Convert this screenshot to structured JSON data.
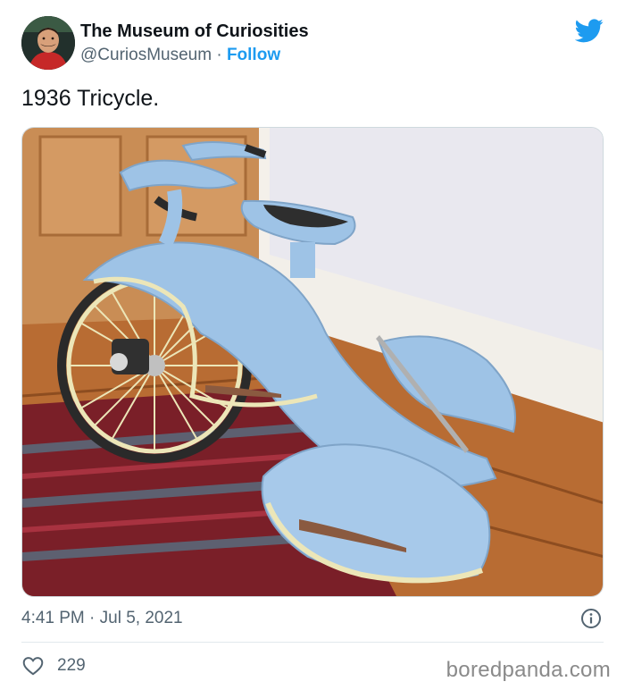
{
  "author": {
    "name": "The Museum of Curiosities",
    "handle": "@CuriosMuseum",
    "separator": " · ",
    "follow_label": "Follow"
  },
  "tweet": {
    "text": "1936 Tricycle.",
    "timestamp": "4:41 PM · Jul 5, 2021",
    "likes": "229"
  },
  "icons": {
    "brand": "twitter-bird-icon",
    "info": "info-icon",
    "like": "heart-icon"
  },
  "colors": {
    "accent": "#1d9bf0",
    "text": "#0f1419",
    "muted": "#536471",
    "tricycle_body": "#9ec3e6"
  },
  "watermark": "boredpanda.com"
}
